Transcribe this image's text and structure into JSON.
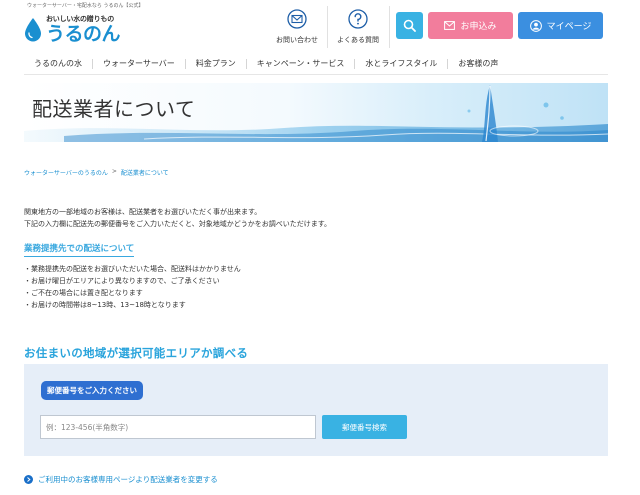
{
  "header": {
    "tagline": "ウォーターサーバー・宅配水なら うるのん【公式】",
    "logo_sub": "おいしい水の贈りもの",
    "logo_name": "うるのん",
    "contact_label": "お問い合わせ",
    "faq_label": "よくある質問",
    "apply_label": "お申込み",
    "mypage_label": "マイページ"
  },
  "nav": {
    "items": [
      "うるのんの水",
      "ウォーターサーバー",
      "料金プラン",
      "キャンペーン・サービス",
      "水とライフスタイル",
      "お客様の声"
    ]
  },
  "hero": {
    "title": "配送業者について"
  },
  "breadcrumb": {
    "home": "ウォーターサーバーのうるのん",
    "separator": ">",
    "current": "配送業者について"
  },
  "intro": {
    "line1": "関東地方の一部地域のお客様は、配送業者をお選びいただく事が出来ます。",
    "line2": "下記の入力欄に配送先の郵便番号をご入力いただくと、対象地域かどうかをお調べいただけます。"
  },
  "partner_section": {
    "heading": "業務提携先での配送について",
    "bullets": [
      "・業務提携先の配送をお選びいただいた場合、配送料はかかりません",
      "・お届け曜日がエリアにより異なりますので、ご了承ください",
      "・ご不在の場合には置き配となります",
      "・お届けの時間帯は8~13時、13~18時となります"
    ]
  },
  "area_check": {
    "heading": "お住まいの地域が選択可能エリアか調べる",
    "zip_label": "郵便番号をご入力ください",
    "zip_value": "",
    "zip_placeholder": "例：123-456(半角数字)",
    "search_button": "郵便番号検索"
  },
  "footer_link": {
    "label": "ご利用中のお客様専用ページより配送業者を変更する"
  },
  "colors": {
    "brand_blue": "#1a8fd0",
    "accent_cyan": "#39b2e3",
    "apply_pink": "#f27d9c",
    "mypage_blue": "#3b8fe0",
    "panel_bg": "#e6eef8",
    "label_blue": "#2f6fd1"
  },
  "icons": [
    "water-drop-logo-icon",
    "mail-icon",
    "question-icon",
    "search-icon",
    "envelope-icon",
    "user-icon",
    "chevron-right-icon"
  ]
}
